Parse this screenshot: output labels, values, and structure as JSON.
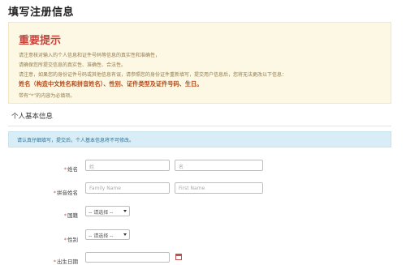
{
  "page": {
    "title": "填写注册信息"
  },
  "notice": {
    "title": "重要提示",
    "lines": [
      "请注意核对输入的个人信息和证件号码等信息的真实性和准确性，",
      "请确保您所提交信息的真实性、准确性、合法性。",
      "请注意，如果您的身份证件号码或其他信息有误，请参照您的身份证件重新填写，提交用户信息后，您将无法更改以下信息：",
      "姓名（构造中文姓名和拼音姓名）、性别、证件类型及证件号码、生日。",
      "带有“*”的内容为必填项。"
    ],
    "required_star": "*"
  },
  "section": {
    "title": "个人基本信息",
    "info": "请认真仔细填写，提交后，个人基本信息将不可修改。"
  },
  "form": {
    "required_mark": "*",
    "rows": [
      {
        "label": "姓名",
        "fields": [
          {
            "placeholder": "姓"
          },
          {
            "placeholder": "名"
          }
        ]
      },
      {
        "label": "拼音姓名",
        "fields": [
          {
            "placeholder": "Family Name"
          },
          {
            "placeholder": "First Name"
          }
        ]
      },
      {
        "label": "国籍",
        "select": "-- 请选择 --"
      },
      {
        "label": "性别",
        "select": "-- 请选择 --"
      },
      {
        "label": "出生日期"
      }
    ]
  },
  "colors": {
    "notice_bg": "#fcf8e3",
    "notice_title": "#c9433d",
    "info_bg": "#d9edf7",
    "required": "#d9534f"
  }
}
